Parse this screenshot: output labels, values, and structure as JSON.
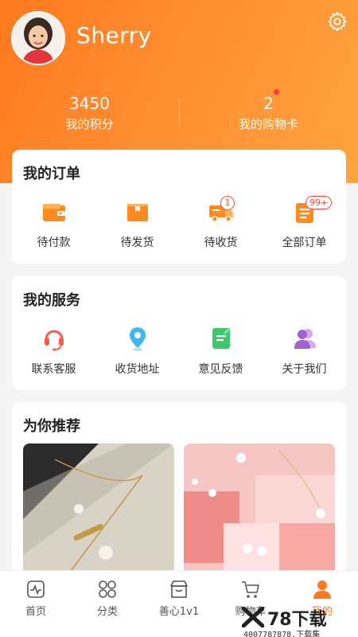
{
  "profile": {
    "username": "Sherry"
  },
  "stats": [
    {
      "value": "3450",
      "label": "我的积分"
    },
    {
      "value": "2",
      "label": "我的购物卡"
    }
  ],
  "orders": {
    "title": "我的订单",
    "items": [
      {
        "label": "待付款",
        "icon": "wallet-icon"
      },
      {
        "label": "待发货",
        "icon": "box-icon"
      },
      {
        "label": "待收货",
        "icon": "truck-icon",
        "badge": "1"
      },
      {
        "label": "全部订单",
        "icon": "order-list-icon",
        "badge": "99+"
      }
    ]
  },
  "services": {
    "title": "我的服务",
    "items": [
      {
        "label": "联系客服",
        "icon": "headset-icon"
      },
      {
        "label": "收货地址",
        "icon": "location-pin-icon"
      },
      {
        "label": "意见反馈",
        "icon": "feedback-icon"
      },
      {
        "label": "关于我们",
        "icon": "people-icon"
      }
    ]
  },
  "recommend": {
    "title": "为你推荐"
  },
  "tabbar": [
    {
      "label": "首页",
      "icon": "home-pulse-icon"
    },
    {
      "label": "分类",
      "icon": "category-grid-icon"
    },
    {
      "label": "善心1v1",
      "icon": "shop-icon"
    },
    {
      "label": "购物车",
      "icon": "cart-icon"
    },
    {
      "label": "我的",
      "icon": "user-icon",
      "active": true
    }
  ],
  "watermark": {
    "brand": "78下载",
    "site": "4007787878.下载集"
  },
  "colors": {
    "accent": "#ff7a1f",
    "badge": "#ff4a3a"
  }
}
